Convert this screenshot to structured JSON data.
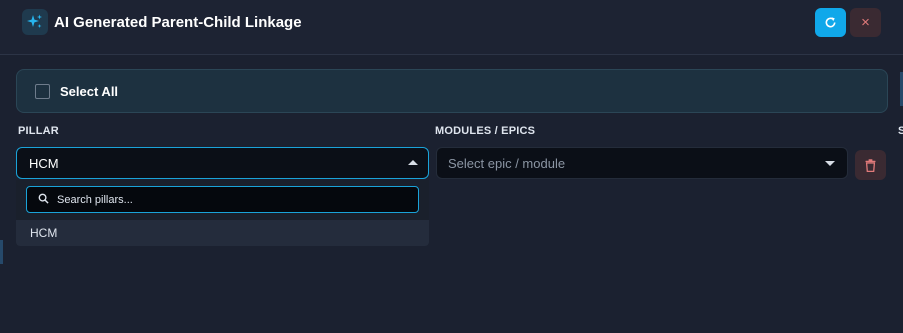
{
  "header": {
    "title": "AI Generated Parent-Child Linkage",
    "icon": "sparkle-icon",
    "refresh_icon": "refresh-icon",
    "close_label": "×"
  },
  "select_all": {
    "label": "Select All",
    "checked": false
  },
  "columns": {
    "pillar": "PILLAR",
    "modules": "MODULES / EPICS",
    "edge": "S"
  },
  "pillar_select": {
    "value": "HCM",
    "open": true,
    "search_placeholder": "Search pillars...",
    "options": [
      "HCM"
    ]
  },
  "epic_select": {
    "placeholder": "Select epic / module"
  },
  "delete_icon": "trash-icon",
  "colors": {
    "accent": "#10a8ea",
    "focus_border": "#1aa3d9",
    "danger": "#e07a7a",
    "background": "#1b2130"
  }
}
